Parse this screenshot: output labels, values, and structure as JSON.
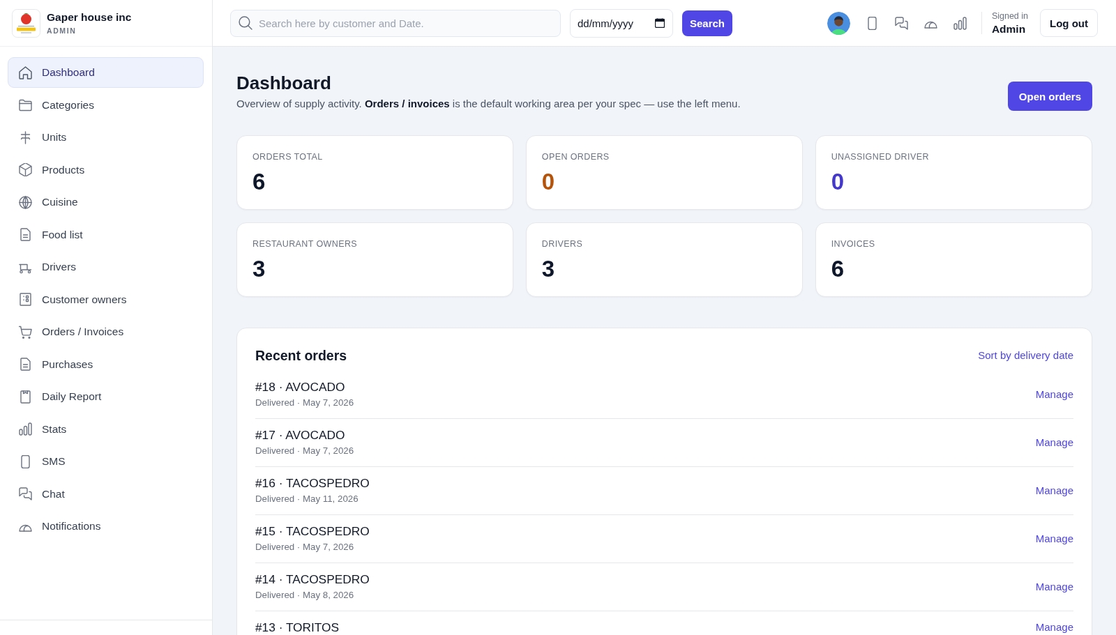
{
  "sidebar": {
    "brand": {
      "name": "Gaper house inc",
      "role": "ADMIN"
    },
    "items": [
      {
        "label": "Dashboard",
        "selected": true
      },
      {
        "label": "Categories",
        "selected": false
      },
      {
        "label": "Units",
        "selected": false
      },
      {
        "label": "Products",
        "selected": false
      },
      {
        "label": "Cuisine",
        "selected": false
      },
      {
        "label": "Food list",
        "selected": false
      },
      {
        "label": "Drivers",
        "selected": false
      },
      {
        "label": "Customer owners",
        "selected": false
      },
      {
        "label": "Orders / Invoices",
        "selected": false
      },
      {
        "label": "Purchases",
        "selected": false
      },
      {
        "label": "Daily Report",
        "selected": false
      },
      {
        "label": "Stats",
        "selected": false
      },
      {
        "label": "SMS",
        "selected": false
      },
      {
        "label": "Chat",
        "selected": false
      },
      {
        "label": "Notifications",
        "selected": false
      }
    ]
  },
  "header": {
    "search": {
      "placeholder": "Search here by customer and Date."
    },
    "date": {
      "placeholder": "dd/mm/yyyy"
    },
    "search_button": "Search",
    "signed_in": {
      "caption": "Signed in",
      "user": "Admin"
    },
    "logout_button": "Log out"
  },
  "page": {
    "title": "Dashboard",
    "subtitle": "Overview of supply activity. **Orders / invoices** is the default working area per your spec — use the left menu.",
    "action_button": "Open orders"
  },
  "stats": [
    {
      "label": "ORDERS TOTAL",
      "value": "6",
      "color": "#0f172a"
    },
    {
      "label": "OPEN ORDERS",
      "value": "0",
      "color": "#b45309"
    },
    {
      "label": "UNASSIGNED DRIVER",
      "value": "0",
      "color": "#4338ca"
    },
    {
      "label": "RESTAURANT OWNERS",
      "value": "3",
      "color": "#0f172a"
    },
    {
      "label": "DRIVERS",
      "value": "3",
      "color": "#0f172a"
    },
    {
      "label": "INVOICES",
      "value": "6",
      "color": "#0f172a"
    }
  ],
  "recent_orders": {
    "title": "Recent orders",
    "sort_link": "Sort by delivery date",
    "rows": [
      {
        "title": "#18 · AVOCADO",
        "subtitle": "Delivered · May 7, 2026",
        "action": "Manage"
      },
      {
        "title": "#17 · AVOCADO",
        "subtitle": "Delivered · May 7, 2026",
        "action": "Manage"
      },
      {
        "title": "#16 · TACOSPEDRO",
        "subtitle": "Delivered · May 11, 2026",
        "action": "Manage"
      },
      {
        "title": "#15 · TACOSPEDRO",
        "subtitle": "Delivered · May 7, 2026",
        "action": "Manage"
      },
      {
        "title": "#14 · TACOSPEDRO",
        "subtitle": "Delivered · May 8, 2026",
        "action": "Manage"
      },
      {
        "title": "#13 · TORITOS",
        "action": "Manage"
      }
    ]
  }
}
